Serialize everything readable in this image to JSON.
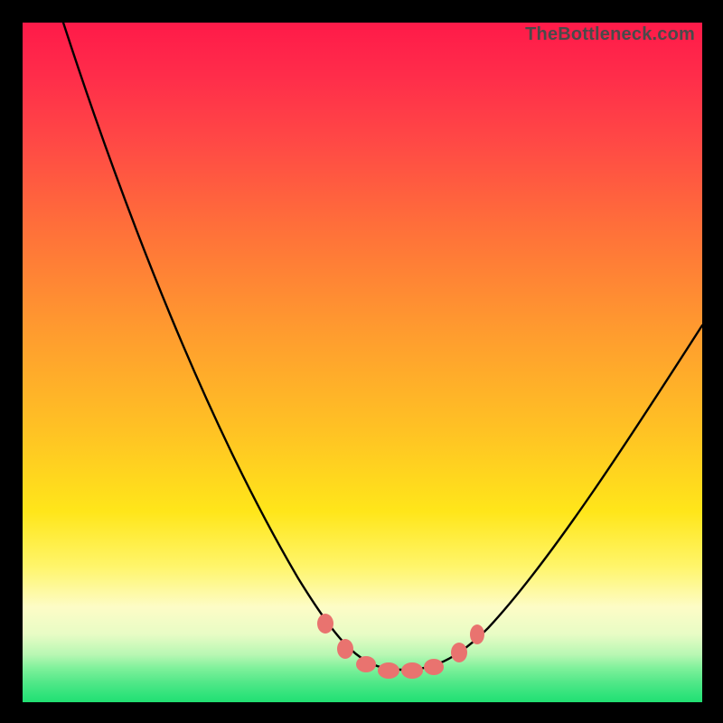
{
  "watermark": "TheBottleneck.com",
  "colors": {
    "background": "#000000",
    "curve": "#000000",
    "marker": "#e9736f",
    "gradient_top": "#ff1a49",
    "gradient_bottom": "#21df72"
  },
  "chart_data": {
    "type": "line",
    "title": "",
    "xlabel": "",
    "ylabel": "",
    "xlim": [
      0,
      100
    ],
    "ylim": [
      0,
      100
    ],
    "grid": false,
    "legend": false,
    "series": [
      {
        "name": "bottleneck-curve",
        "x": [
          0,
          5,
          10,
          15,
          20,
          25,
          30,
          35,
          40,
          43,
          46,
          49,
          52,
          55,
          58,
          60,
          63,
          66,
          70,
          75,
          80,
          85,
          90,
          95,
          100
        ],
        "values": [
          100,
          91,
          82,
          73,
          64,
          55,
          46,
          37,
          28,
          20,
          13,
          7,
          3,
          1,
          1,
          1,
          2,
          5,
          11,
          20,
          29,
          37,
          44,
          51,
          57
        ]
      }
    ],
    "markers": {
      "name": "highlight-points",
      "x": [
        46,
        49,
        52,
        55,
        58,
        60,
        63
      ],
      "values": [
        13,
        7,
        3,
        1,
        1,
        1,
        2
      ]
    },
    "annotations": []
  }
}
